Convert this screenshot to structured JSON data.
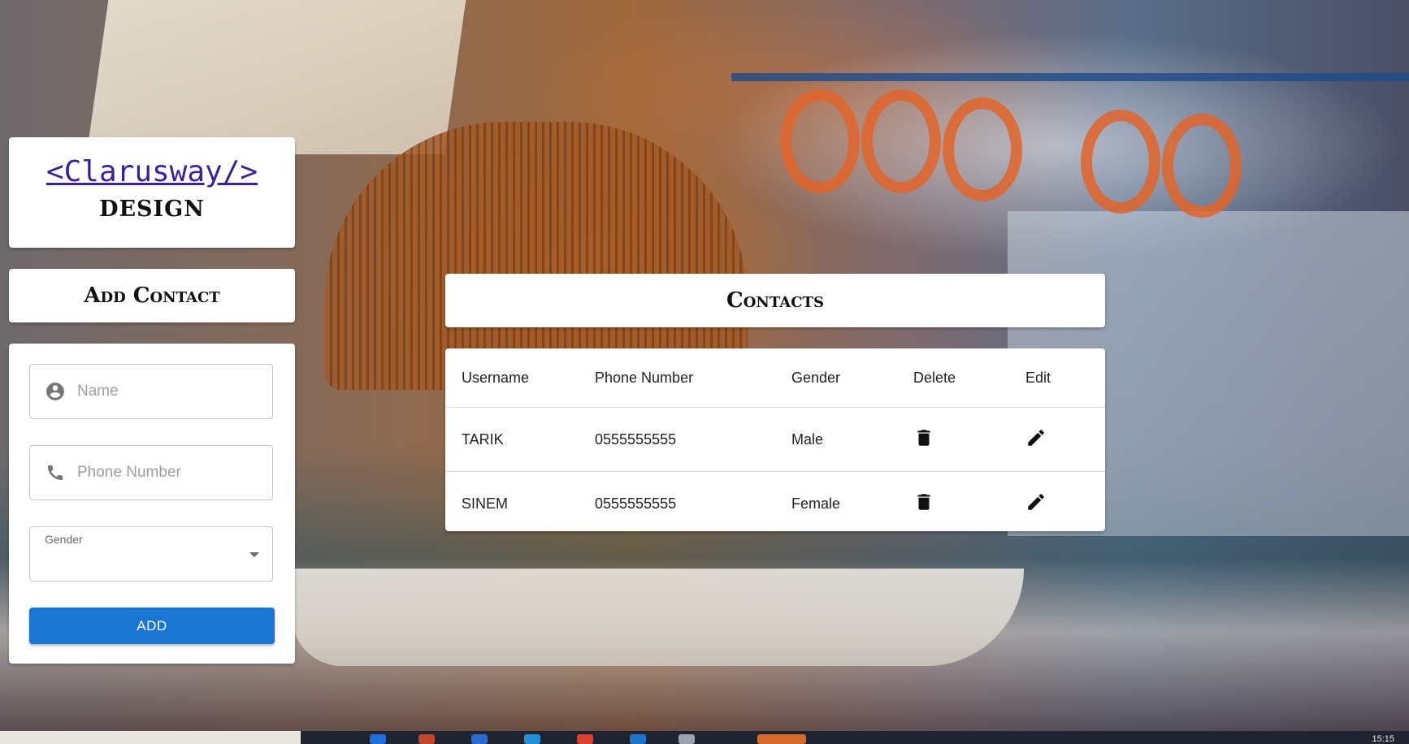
{
  "logo": {
    "brand": "<Clarusway/>",
    "subtitle": "DESIGN"
  },
  "add_contact": {
    "title": "Add Contact",
    "name_placeholder": "Name",
    "phone_placeholder": "Phone Number",
    "gender_label": "Gender",
    "gender_value": "",
    "add_button": "ADD"
  },
  "contacts": {
    "title": "Contacts",
    "headers": [
      "Username",
      "Phone Number",
      "Gender",
      "Delete",
      "Edit"
    ],
    "rows": [
      {
        "username": "TARIK",
        "phone": "0555555555",
        "gender": "Male"
      },
      {
        "username": "SINEM",
        "phone": "0555555555",
        "gender": "Female"
      }
    ]
  },
  "icons": {
    "name": "account-circle-icon",
    "phone": "phone-icon",
    "dropdown": "arrow-drop-down-icon",
    "delete": "trash-icon",
    "edit": "pencil-icon"
  },
  "colors": {
    "primary": "#1976d2",
    "brand_link": "#3a1fa0"
  },
  "taskbar": {
    "clock": "15:15"
  }
}
